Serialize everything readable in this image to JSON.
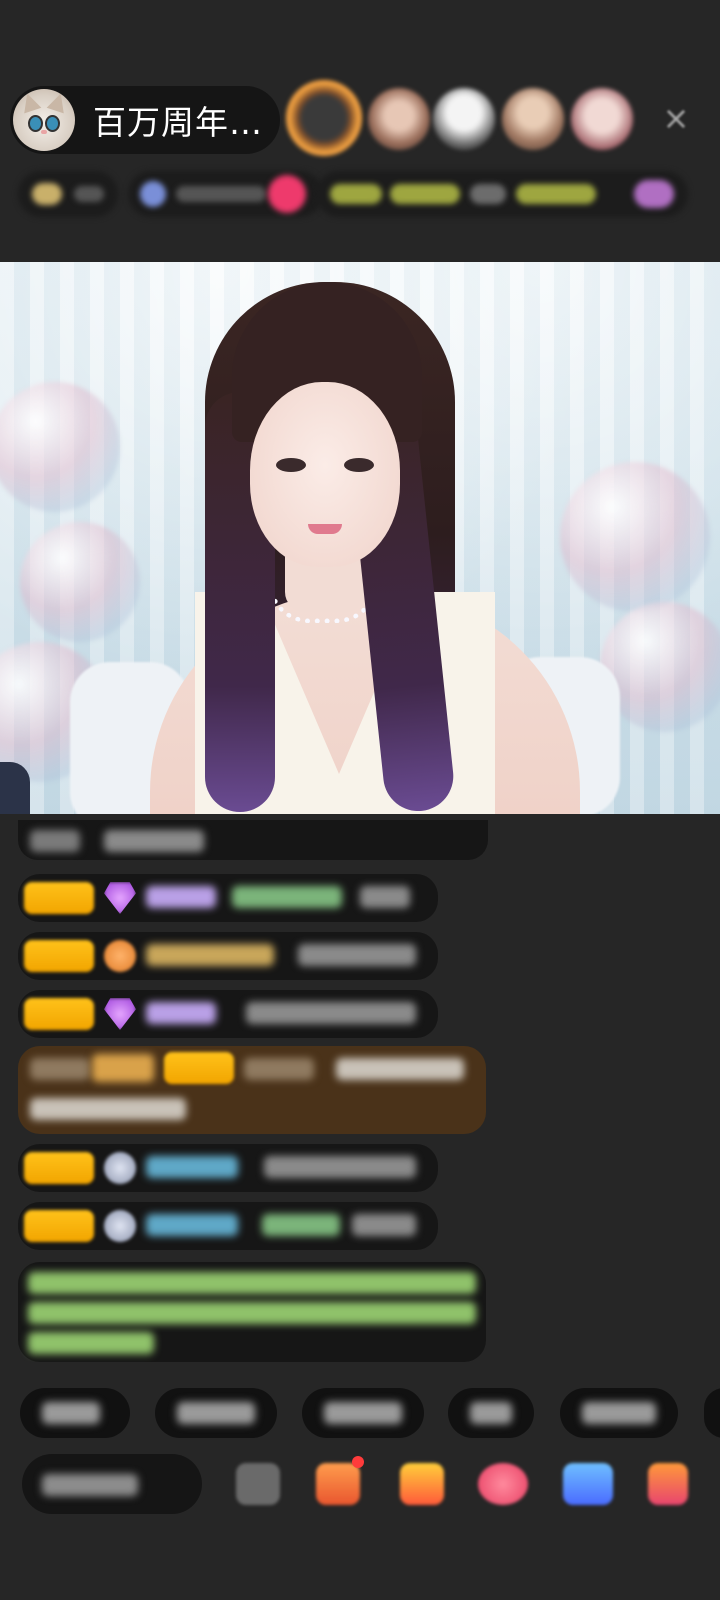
{
  "header": {
    "host_name": "百万周年…",
    "close_icon": "×"
  },
  "colors": {
    "background": "#262626",
    "badge_gold": "#f2a500",
    "chat_box": "#161616"
  }
}
